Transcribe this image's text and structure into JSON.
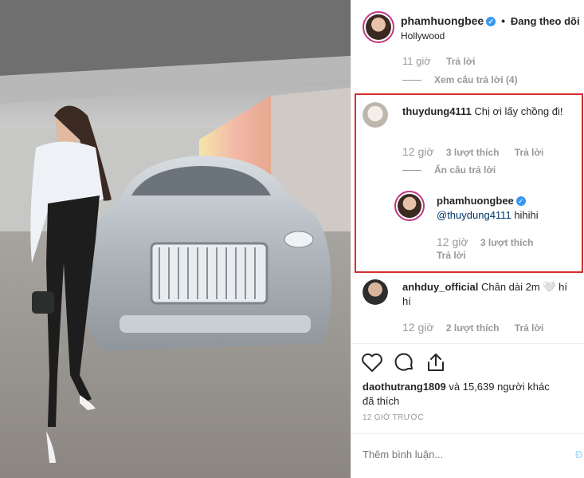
{
  "header": {
    "username": "phamhuongbee",
    "separator": "•",
    "follow_status": "Đang theo dõi",
    "location": "Hollywood"
  },
  "prev_comment": {
    "time": "11 giờ",
    "reply": "Trả lời",
    "view_replies": "Xem câu trả lời (4)"
  },
  "comment1": {
    "username": "thuydung4111",
    "text": "Chị ơi lấy chồng đi!",
    "time": "12 giờ",
    "likes": "3 lượt thích",
    "reply": "Trả lời",
    "hide_replies": "Ẩn câu trả lời"
  },
  "reply1": {
    "username": "phamhuongbee",
    "mention": "@thuydung4111",
    "text": "hihihi",
    "time": "12 giờ",
    "likes": "3 lượt thích",
    "reply": "Trả lời"
  },
  "comment2": {
    "username": "anhduy_official",
    "text": "Chân dài 2m 🤍 hí hí",
    "time": "12 giờ",
    "likes": "2 lượt thích",
    "reply": "Trả lời"
  },
  "actions": {
    "like_icon": "heart-icon",
    "comment_icon": "comment-icon",
    "share_icon": "share-icon"
  },
  "likes": {
    "first_user": "daothutrang1809",
    "rest": "và 15,639 người khác",
    "suffix": "đã thích"
  },
  "post_time": "12 GIỜ TRƯỚC",
  "comment_input": {
    "placeholder": "Thêm bình luận...",
    "post_label": "Đ"
  },
  "colors": {
    "highlight_border": "#d32f2f",
    "verified": "#3897f0",
    "meta": "#999999"
  }
}
